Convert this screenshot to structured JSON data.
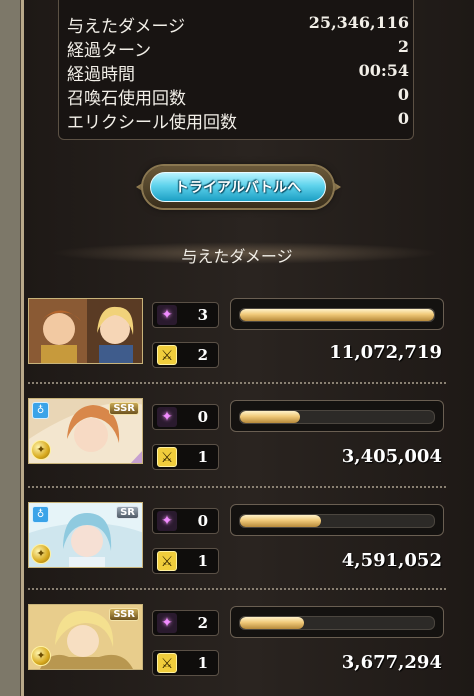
{
  "stats": [
    {
      "label": "与えたダメージ",
      "value": "25,346,116"
    },
    {
      "label": "経過ターン",
      "value": "2"
    },
    {
      "label": "経過時間",
      "value": "00:54"
    },
    {
      "label": "召喚石使用回数",
      "value": "0"
    },
    {
      "label": "エリクシール使用回数",
      "value": "0"
    }
  ],
  "trial_button": {
    "label": "トライアルバトルへ"
  },
  "section_title": "与えたダメージ",
  "characters": [
    {
      "portrait": "main-character-duo",
      "rarity": "",
      "element": "",
      "ougi_count": "3",
      "skill_count": "2",
      "damage": "11,072,719",
      "damage_fraction": 1.0
    },
    {
      "portrait": "orange-haired-woman",
      "rarity": "SSR",
      "element": "water",
      "ougi_count": "0",
      "skill_count": "1",
      "damage": "3,405,004",
      "damage_fraction": 0.307
    },
    {
      "portrait": "blue-haired-woman",
      "rarity": "SR",
      "element": "water",
      "ougi_count": "0",
      "skill_count": "1",
      "damage": "4,591,052",
      "damage_fraction": 0.415
    },
    {
      "portrait": "blonde-man",
      "rarity": "SSR",
      "element": "light",
      "ougi_count": "2",
      "skill_count": "1",
      "damage": "3,677,294",
      "damage_fraction": 0.332
    }
  ],
  "colors": {
    "bar_fill": "#f0c979",
    "ougi_icon": "#f18cff",
    "skill_icon": "#f0cd3c",
    "button": "#5fd3ec"
  }
}
